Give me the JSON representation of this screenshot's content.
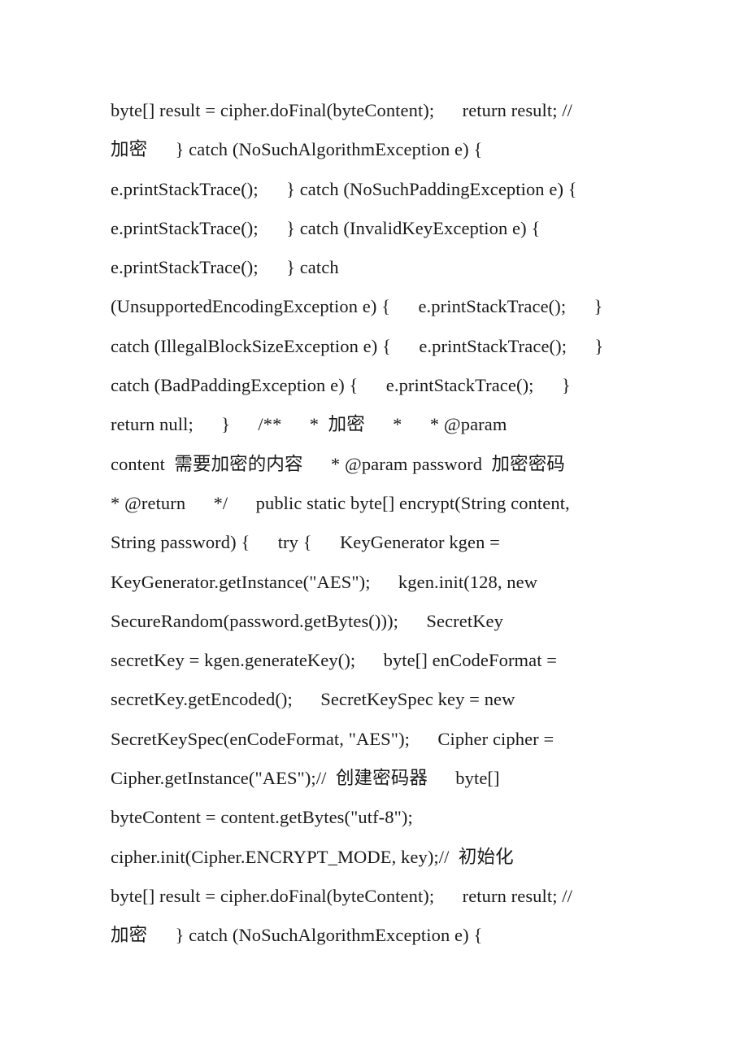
{
  "document": {
    "page_background": "#ffffff",
    "text_color": "#1a1a1a",
    "body_lines": [
      "byte[] result = cipher.doFinal(byteContent);      return result; //",
      "加密      } catch (NoSuchAlgorithmException e) {",
      "e.printStackTrace();      } catch (NoSuchPaddingException e) {",
      "e.printStackTrace();      } catch (InvalidKeyException e) {",
      "e.printStackTrace();      } catch",
      "(UnsupportedEncodingException e) {      e.printStackTrace();      }",
      "catch (IllegalBlockSizeException e) {      e.printStackTrace();      }",
      "catch (BadPaddingException e) {      e.printStackTrace();      }",
      "return null;      }      /**      *  加密      *      * @param",
      "content  需要加密的内容      * @param password  加密密码",
      "* @return      */      public static byte[] encrypt(String content,",
      "String password) {      try {      KeyGenerator kgen =",
      "KeyGenerator.getInstance(\"AES\");      kgen.init(128, new",
      "SecureRandom(password.getBytes()));      SecretKey",
      "secretKey = kgen.generateKey();      byte[] enCodeFormat =",
      "secretKey.getEncoded();      SecretKeySpec key = new",
      "SecretKeySpec(enCodeFormat, \"AES\");      Cipher cipher =",
      "Cipher.getInstance(\"AES\");//  创建密码器      byte[]",
      "byteContent = content.getBytes(\"utf-8\");",
      "cipher.init(Cipher.ENCRYPT_MODE, key);//  初始化",
      "byte[] result = cipher.doFinal(byteContent);      return result; //",
      "加密      } catch (NoSuchAlgorithmException e) {"
    ]
  }
}
